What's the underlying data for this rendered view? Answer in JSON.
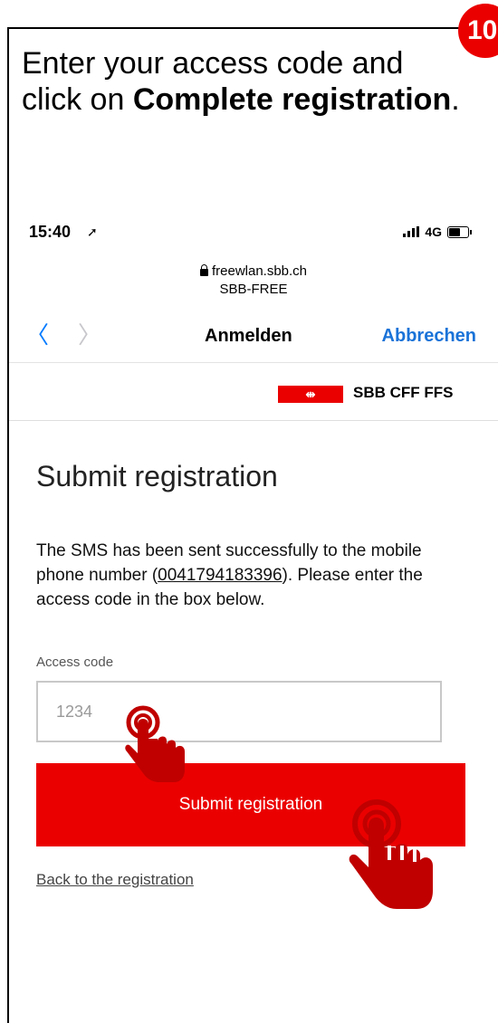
{
  "step_badge": "10",
  "instruction": {
    "line_part1": "Enter your access code and click on ",
    "bold": "Complete registration",
    "line_part2": "."
  },
  "status_bar": {
    "time": "15:40",
    "network": "4G"
  },
  "browser": {
    "url": "freewlan.sbb.ch",
    "network_name": "SBB-FREE"
  },
  "nav": {
    "back_icon": "chevron-left-icon",
    "forward_icon": "chevron-right-icon",
    "title": "Anmelden",
    "cancel_label": "Abbrechen"
  },
  "brand": {
    "logo_glyph": "⇹",
    "name": "SBB CFF FFS",
    "color": "#eb0000"
  },
  "form": {
    "title": "Submit registration",
    "description_part1": "The SMS has been sent successfully to the mobile phone number (",
    "phone_number": "0041794183396",
    "description_part2": "). Please enter the access code in the box below.",
    "access_code_label": "Access code",
    "access_code_placeholder": "1234",
    "submit_label": "Submit registration",
    "back_link": "Back to the registration"
  },
  "colors": {
    "accent_red": "#eb0000",
    "ios_blue": "#007aff"
  }
}
